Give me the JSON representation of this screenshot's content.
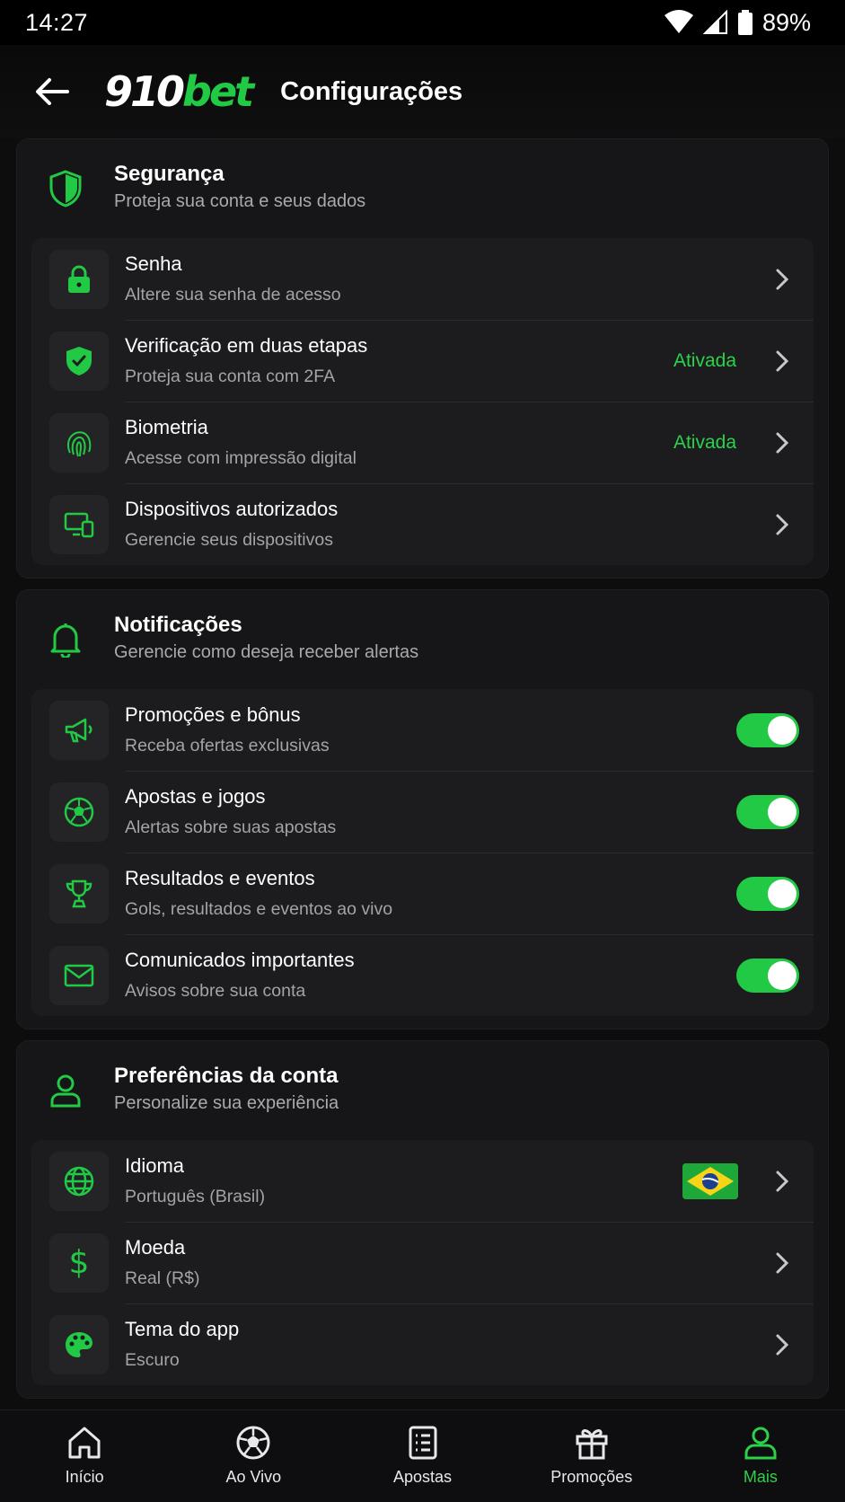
{
  "status_bar": {
    "time": "14:27",
    "battery": "89%"
  },
  "app_bar": {
    "logo_number": "910",
    "logo_brand": "bet",
    "title": "Configurações"
  },
  "sections": {
    "security": {
      "title": "Segurança",
      "subtitle": "Proteja sua conta e seus dados",
      "items": [
        {
          "title": "Senha",
          "subtitle": "Altere sua senha de acesso",
          "icon": "lock-icon"
        },
        {
          "title": "Verificação em duas etapas",
          "subtitle": "Proteja sua conta com 2FA",
          "status": "Ativada",
          "icon": "shield-check-icon"
        },
        {
          "title": "Biometria",
          "subtitle": "Acesse com impressão digital",
          "status": "Ativada",
          "icon": "fingerprint-icon"
        },
        {
          "title": "Dispositivos autorizados",
          "subtitle": "Gerencie seus dispositivos",
          "icon": "devices-icon"
        }
      ]
    },
    "notifications": {
      "title": "Notificações",
      "subtitle": "Gerencie como deseja receber alertas",
      "items": [
        {
          "title": "Promoções e bônus",
          "subtitle": "Receba ofertas exclusivas",
          "enabled": true,
          "icon": "megaphone-icon"
        },
        {
          "title": "Apostas e jogos",
          "subtitle": "Alertas sobre suas apostas",
          "enabled": true,
          "icon": "soccer-ball-icon"
        },
        {
          "title": "Resultados e eventos",
          "subtitle": "Gols, resultados e eventos ao vivo",
          "enabled": true,
          "icon": "trophy-icon"
        },
        {
          "title": "Comunicados importantes",
          "subtitle": "Avisos sobre sua conta",
          "enabled": true,
          "icon": "mail-icon"
        }
      ]
    },
    "preferences": {
      "title": "Preferências da conta",
      "subtitle": "Personalize sua experiência",
      "items": [
        {
          "title": "Idioma",
          "subtitle": "Português (Brasil)",
          "icon": "globe-icon"
        },
        {
          "title": "Moeda",
          "subtitle": "Real (R$)",
          "icon": "dollar-icon"
        },
        {
          "title": "Tema do app",
          "subtitle": "Escuro",
          "icon": "palette-icon"
        }
      ]
    }
  },
  "bottom_nav": [
    {
      "label": "Início",
      "icon": "home-icon"
    },
    {
      "label": "Ao Vivo",
      "icon": "soccer-ball-icon"
    },
    {
      "label": "Apostas",
      "icon": "list-icon"
    },
    {
      "label": "Promoções",
      "icon": "gift-icon"
    },
    {
      "label": "Mais",
      "icon": "user-icon",
      "active": true
    }
  ],
  "colors": {
    "accent": "#22c945",
    "background": "#0d0d0e",
    "card": "#161618"
  }
}
